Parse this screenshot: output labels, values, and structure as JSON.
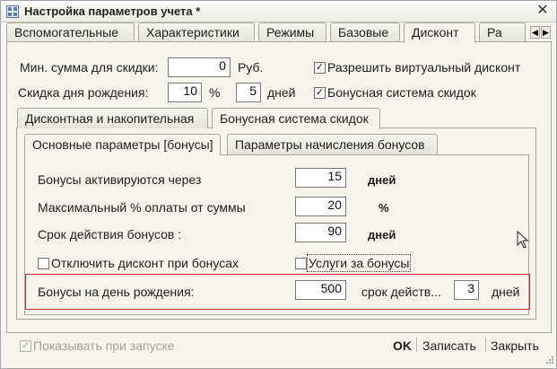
{
  "window": {
    "title": "Настройка параметров учета *",
    "close_symbol": "✕"
  },
  "tabs_top": [
    {
      "label": "Вспомогательные",
      "active": false
    },
    {
      "label": "Характеристики",
      "active": false
    },
    {
      "label": "Режимы",
      "active": false
    },
    {
      "label": "Базовые",
      "active": false
    },
    {
      "label": "Дисконт",
      "active": true
    },
    {
      "label": "Ра",
      "active": false
    }
  ],
  "tab_scroll": {
    "left": "◀",
    "right": "▶"
  },
  "discount": {
    "min_sum_label": "Мин. сумма для скидки:",
    "min_sum_value": "0",
    "min_sum_unit": "Руб.",
    "allow_virtual_label": "Разрешить виртуальный дисконт",
    "allow_virtual_checked": "✓",
    "birthday_discount_label": "Скидка дня рождения:",
    "birthday_discount_value": "10",
    "birthday_discount_unit": "%",
    "birthday_days_value": "5",
    "birthday_days_unit": "дней",
    "bonus_system_label": "Бонусная система скидок",
    "bonus_system_checked": "✓"
  },
  "tabs_mid": [
    {
      "label": "Дисконтная и накопительная",
      "active": false
    },
    {
      "label": "Бонусная система скидок",
      "active": true
    }
  ],
  "tabs_inner": [
    {
      "label": "Основные параметры [бонусы]",
      "active": true
    },
    {
      "label": "Параметры начисления бонусов",
      "active": false
    }
  ],
  "bonus": {
    "activate_label": "Бонусы активируются через",
    "activate_value": "15",
    "activate_unit": "дней",
    "max_pct_label": "Максимальный % оплаты от суммы",
    "max_pct_value": "20",
    "max_pct_unit": "%",
    "validity_label": "Срок действия бонусов :",
    "validity_value": "90",
    "validity_unit": "дней",
    "disable_discount_label": "Отключить дисконт при бонусах",
    "services_label": "Услуги за бонусы",
    "birthday_bonus_label": "Бонусы на день рождения:",
    "birthday_bonus_value": "500",
    "birthday_term_label": "срок действ...",
    "birthday_term_value": "3",
    "birthday_term_unit": "дней"
  },
  "footer": {
    "show_on_start_label": "Показывать при запуске",
    "show_on_start_checked": "✓",
    "ok_label": "OK",
    "save_label": "Записать",
    "close_label": "Закрыть"
  }
}
